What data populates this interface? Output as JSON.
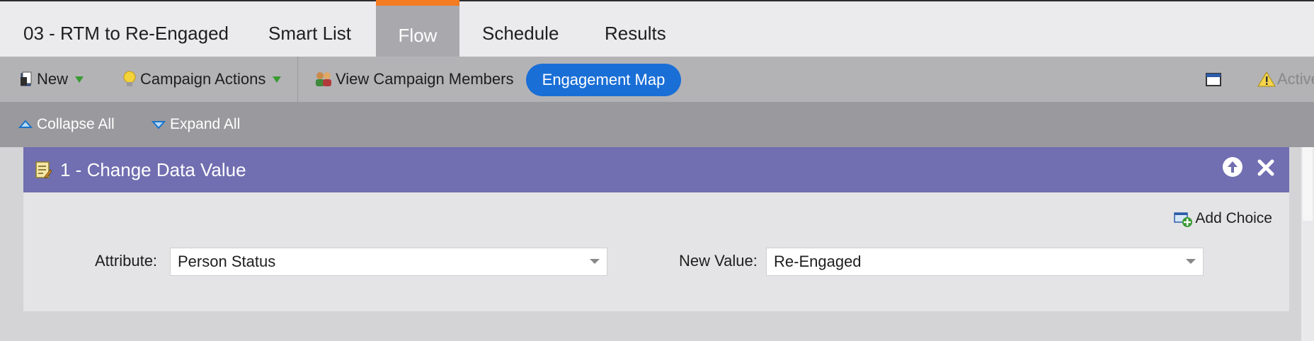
{
  "tabs": [
    {
      "label": "03 - RTM to Re-Engaged",
      "active": false
    },
    {
      "label": "Smart List",
      "active": false
    },
    {
      "label": "Flow",
      "active": true
    },
    {
      "label": "Schedule",
      "active": false
    },
    {
      "label": "Results",
      "active": false
    }
  ],
  "toolbar": {
    "new_label": "New",
    "campaign_actions_label": "Campaign Actions",
    "view_members_label": "View Campaign Members",
    "engagement_map_label": "Engagement Map",
    "active_label": "Active"
  },
  "subbar": {
    "collapse_label": "Collapse All",
    "expand_label": "Expand All"
  },
  "step": {
    "title": "1 - Change Data Value",
    "add_choice_label": "Add Choice",
    "attribute_label": "Attribute:",
    "attribute_value": "Person Status",
    "new_value_label": "New Value:",
    "new_value_value": "Re-Engaged"
  },
  "colors": {
    "accent_tab": "#f47b20",
    "step_header": "#716eb1",
    "pill": "#1a6fd6"
  }
}
